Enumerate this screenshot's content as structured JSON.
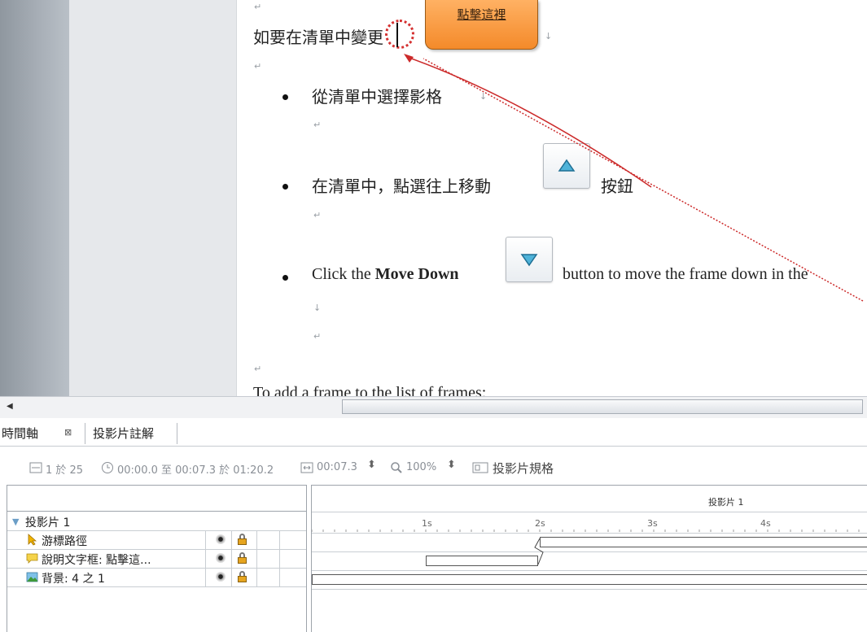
{
  "document": {
    "para_mark": "↵",
    "line_break": "↓",
    "intro_text": "如要在清單中變更",
    "callout_label": "點擊這裡",
    "bullets": [
      {
        "text": "從清單中選擇影格"
      },
      {
        "text_before": "在清單中，點選往上移動",
        "text_after": "按鈕"
      },
      {
        "text_before": "Click the ",
        "bold": "Move Down",
        "text_after": "button to move the frame down in the"
      }
    ],
    "footer_text": "To add a frame to the list of frames:"
  },
  "scrollbar": {
    "left_arrow": "◀"
  },
  "tabs": {
    "timeline": "時間軸",
    "close_glyph": "⊠",
    "notes": "投影片註解"
  },
  "toolbar": {
    "slide_count": "1 於 25",
    "time_range": "00:00.0 至 00:07.3 於 01:20.2",
    "duration": "00:07.3",
    "zoom": "100%",
    "slide_props": "投影片規格"
  },
  "timeline": {
    "slide_header": "投影片 1",
    "ruler_title": "投影片 1",
    "ruler_marks": [
      "1s",
      "2s",
      "3s",
      "4s"
    ],
    "layers": [
      {
        "name": "游標路徑"
      },
      {
        "name": "說明文字框: 點擊這..."
      },
      {
        "name": "背景: 4 之 1"
      }
    ]
  },
  "colors": {
    "callout": "#f48a2a",
    "cursor_ring": "#d43030",
    "path_line": "#cc2a2a"
  }
}
